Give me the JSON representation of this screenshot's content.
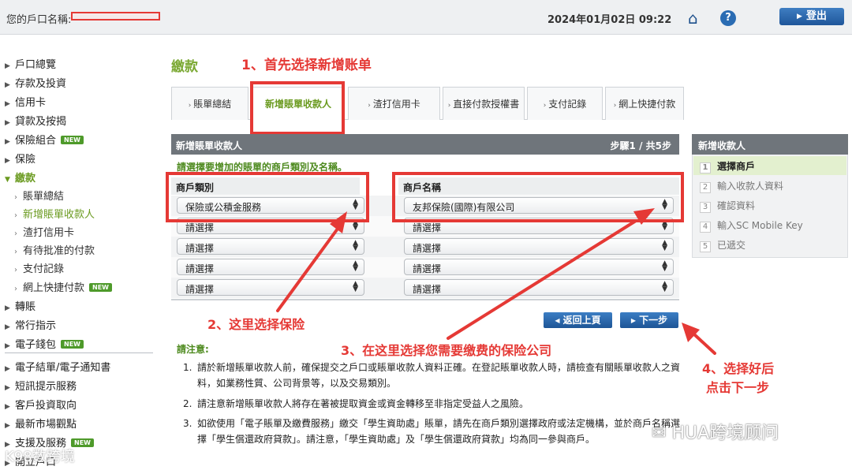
{
  "topbar": {
    "account_label": "您的戶口名稱:",
    "datetime": "2024年01月02日 09:22",
    "logout_label": "登出"
  },
  "sidebar": {
    "items": [
      {
        "label": "戶口總覽"
      },
      {
        "label": "存款及投資"
      },
      {
        "label": "信用卡"
      },
      {
        "label": "貸款及按揭"
      },
      {
        "label": "保險組合",
        "badge": "NEW"
      },
      {
        "label": "保險"
      },
      {
        "label": "繳款"
      },
      {
        "label": "轉賬"
      },
      {
        "label": "常行指示"
      },
      {
        "label": "電子錢包",
        "badge": "NEW"
      },
      {
        "label": "電子結單/電子通知書"
      },
      {
        "label": "短訊提示服務"
      },
      {
        "label": "客戶投資取向"
      },
      {
        "label": "最新市場觀點"
      },
      {
        "label": "支援及服務",
        "badge": "NEW"
      },
      {
        "label": "開立戶口"
      }
    ],
    "sub_items": [
      {
        "label": "賬單總結"
      },
      {
        "label": "新增賬單收款人"
      },
      {
        "label": "渣打信用卡"
      },
      {
        "label": "有待批准的付款"
      },
      {
        "label": "支付記錄"
      },
      {
        "label": "網上快捷付款",
        "badge": "NEW"
      }
    ]
  },
  "main": {
    "title": "繳款",
    "tabs": [
      {
        "label": "賬單總結"
      },
      {
        "label": "新增賬單收款人"
      },
      {
        "label": "渣打信用卡"
      },
      {
        "label": "直接付款授權書"
      },
      {
        "label": "支付記錄"
      },
      {
        "label": "網上快捷付款"
      }
    ],
    "panel_title": "新增賬單收款人",
    "step_indicator": "步驟1 / 共5步",
    "instruction": "請選擇要增加的賬單的商戶類別及名稱。",
    "col_category": "商戶類別",
    "col_name": "商戶名稱",
    "rows": [
      {
        "category": "保險或公積金服務",
        "name": "友邦保險(國際)有限公司"
      },
      {
        "category": "請選擇",
        "name": "請選擇"
      },
      {
        "category": "請選擇",
        "name": "請選擇"
      },
      {
        "category": "請選擇",
        "name": "請選擇"
      },
      {
        "category": "請選擇",
        "name": "請選擇"
      }
    ],
    "back_button": "返回上頁",
    "next_button": "下一步",
    "notes_title": "請注意:",
    "notes": [
      {
        "num": "1.",
        "text": "請於新增賬單收款人前，確保提交之戶口或賬單收款人資料正確。在登記賬單收款人時，請檢查有關賬單收款人之資料，如業務性質、公司背景等，以及交易類別。"
      },
      {
        "num": "2.",
        "text": "請注意新增賬單收款人將存在著被提取資金或資金轉移至非指定受益人之風險。"
      },
      {
        "num": "3.",
        "text": "如欲使用「電子賬單及繳費服務」繳交「學生資助處」賬單，請先在商戶類別選擇政府或法定機構，並於商戶名稱選擇「學生償還政府貸款」。請注意，「學生資助處」及「學生償還政府貸款」均為同一參與商戶。"
      }
    ]
  },
  "steps": {
    "title": "新增收款人",
    "items": [
      {
        "num": "1",
        "label": "選擇商戶"
      },
      {
        "num": "2",
        "label": "輸入收款人資料"
      },
      {
        "num": "3",
        "label": "確認資料"
      },
      {
        "num": "4",
        "label": "輸入SC Mobile Key"
      },
      {
        "num": "5",
        "label": "已遞交"
      }
    ]
  },
  "annotations": {
    "a1": "1、首先选择新增账单",
    "a2": "2、这里选择保险",
    "a3": "3、在这里选择您需要缴费的保险公司",
    "a4_line1": "4、选择好后",
    "a4_line2": "点击下一步"
  },
  "watermarks": {
    "w1": "HUA跨境顾问",
    "w2": "K98数跨境"
  },
  "colors": {
    "annotation_red": "#e53935",
    "accent_green": "#7aa832",
    "button_blue": "#2a6cb3"
  }
}
